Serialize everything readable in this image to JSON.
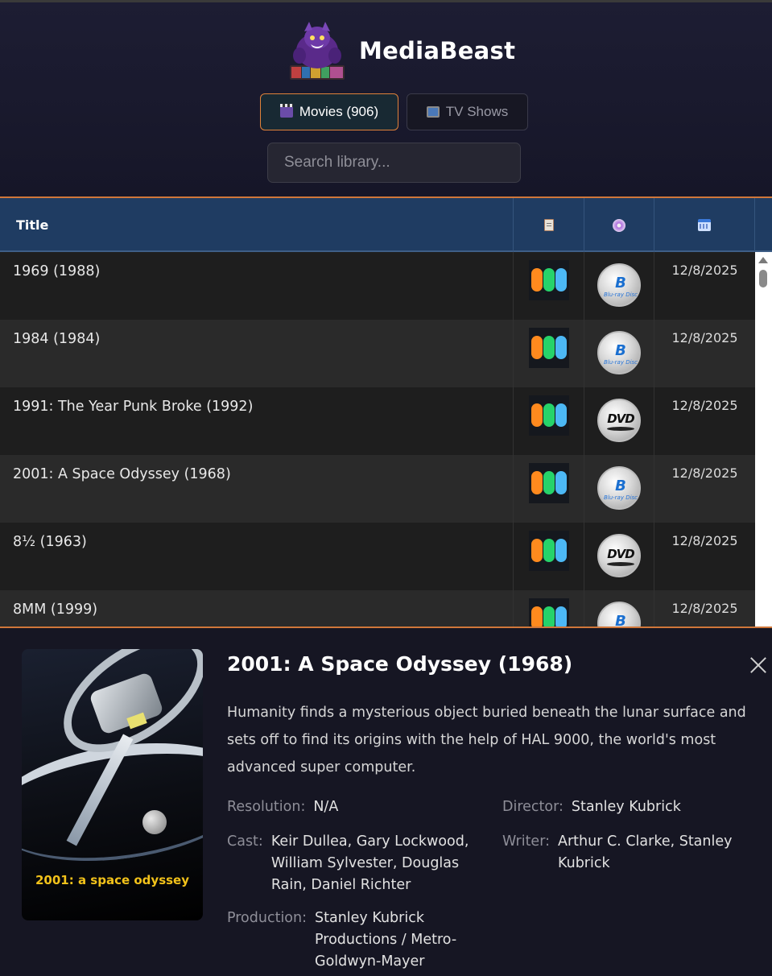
{
  "app": {
    "title": "MediaBeast"
  },
  "tabs": [
    {
      "label": "Movies (906)",
      "icon": "clapperboard-icon",
      "active": true
    },
    {
      "label": "TV Shows",
      "icon": "television-icon",
      "active": false
    }
  ],
  "search": {
    "placeholder": "Search library..."
  },
  "table": {
    "columns": [
      {
        "label": "Title"
      },
      {
        "icon": "clipboard-icon"
      },
      {
        "icon": "disc-icon"
      },
      {
        "icon": "calendar-icon"
      }
    ],
    "rows": [
      {
        "title": "1969 (1988)",
        "source": "plex-dots",
        "format": "Blu-ray",
        "date": "12/8/2025"
      },
      {
        "title": "1984 (1984)",
        "source": "plex-dots",
        "format": "Blu-ray",
        "date": "12/8/2025"
      },
      {
        "title": "1991: The Year Punk Broke (1992)",
        "source": "plex-dots",
        "format": "DVD",
        "date": "12/8/2025"
      },
      {
        "title": "2001: A Space Odyssey (1968)",
        "source": "plex-dots",
        "format": "Blu-ray",
        "date": "12/8/2025"
      },
      {
        "title": "8½ (1963)",
        "source": "plex-dots",
        "format": "DVD",
        "date": "12/8/2025"
      },
      {
        "title": "8MM (1999)",
        "source": "plex-dots",
        "format": "Blu-ray",
        "date": "12/8/2025"
      }
    ]
  },
  "discs": {
    "bluray": {
      "mark": "B",
      "caption": "Blu-ray Disc"
    },
    "dvd": {
      "mark": "DVD"
    }
  },
  "detail": {
    "title": "2001: A Space Odyssey (1968)",
    "description": "Humanity finds a mysterious object buried beneath the lunar surface and sets off to find its origins with the help of HAL 9000, the world's most advanced super computer.",
    "poster_text": "2001: a space odyssey",
    "resolution_label": "Resolution:",
    "resolution": "N/A",
    "director_label": "Director:",
    "director": "Stanley Kubrick",
    "cast_label": "Cast:",
    "cast": "Keir Dullea, Gary Lockwood, William Sylvester, Douglas Rain, Daniel Richter",
    "writer_label": "Writer:",
    "writer": "Arthur C. Clarke, Stanley Kubrick",
    "production_label": "Production:",
    "production": "Stanley Kubrick Productions / Metro-Goldwyn-Mayer"
  },
  "colors": {
    "accent": "#d0773a",
    "header_bg": "#1f3c62",
    "poster_title": "#f2c21a"
  }
}
